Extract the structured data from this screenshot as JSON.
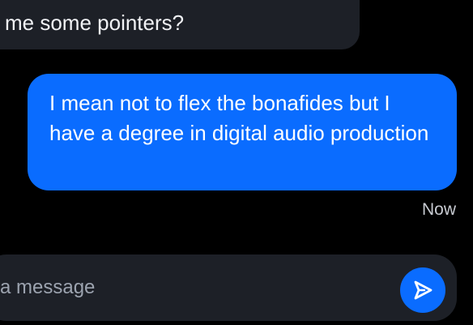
{
  "conversation": {
    "incoming": {
      "text": "me some pointers?"
    },
    "outgoing": {
      "text": "I mean not to flex the bonafides but I have a degree in digital audio production",
      "timestamp": "Now"
    }
  },
  "composer": {
    "placeholder": "a message",
    "send_icon": "send-icon"
  },
  "colors": {
    "background": "#000000",
    "incoming_bubble": "#1d2027",
    "outgoing_bubble": "#0a6cff",
    "accent": "#0a6cff",
    "timestamp": "#c7cad1",
    "placeholder": "#9ca3af"
  }
}
